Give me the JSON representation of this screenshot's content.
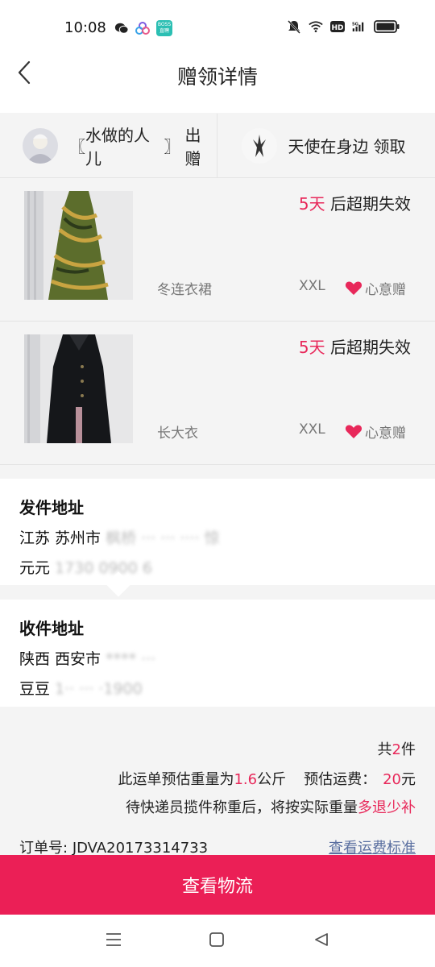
{
  "status": {
    "time": "10:08",
    "boss_text": "BOSS 直聘"
  },
  "header": {
    "title": "赠领详情"
  },
  "users": {
    "giver": {
      "name": "水做的人儿",
      "action": "出赠"
    },
    "receiver": {
      "name": "天使在身边",
      "action": "领取"
    }
  },
  "items": [
    {
      "expire_num": "5天",
      "expire_suffix": " 后超期失效",
      "name": "冬连衣裙",
      "size": "XXL",
      "tag": "心意赠"
    },
    {
      "expire_num": "5天",
      "expire_suffix": " 后超期失效",
      "name": "长大衣",
      "size": "XXL",
      "tag": "心意赠"
    }
  ],
  "sender": {
    "title": "发件地址",
    "line1_visible": "江苏 苏州市",
    "line1_hidden": " 枫桥 ··· ··· ···· 惊",
    "line2_visible": "元元",
    "line2_hidden": " 1730 0900 6"
  },
  "receiver_addr": {
    "title": "收件地址",
    "line1_visible": "陕西 西安市",
    "line1_hidden": " **** ···",
    "line2_visible": "豆豆",
    "line2_hidden": " 1·· ··· ·1900"
  },
  "summary": {
    "count_prefix": "共",
    "count": "2",
    "count_suffix": "件",
    "weight_prefix": "此运单预估重量为",
    "weight": "1.6",
    "weight_unit": "公斤",
    "fee_prefix": "预估运费：",
    "fee": "20",
    "fee_unit": "元",
    "note_prefix": "待快递员揽件称重后，将按实际重量",
    "note_highlight": "多退少补",
    "order_label": "订单号:",
    "order_no": "JDVA20173314733",
    "fee_link": "查看运费标准"
  },
  "footer": {
    "button": "查看物流"
  },
  "colors": {
    "accent": "#eb1f56",
    "highlight": "#e8285a",
    "link": "#5a6fa0"
  },
  "icons": [
    "wechat-icon",
    "app-icon",
    "boss-icon",
    "mute-icon",
    "wifi-icon",
    "hd-icon",
    "signal-5g-icon",
    "battery-icon",
    "back-icon",
    "heart-icon",
    "menu-icon",
    "home-icon",
    "back-nav-icon"
  ]
}
